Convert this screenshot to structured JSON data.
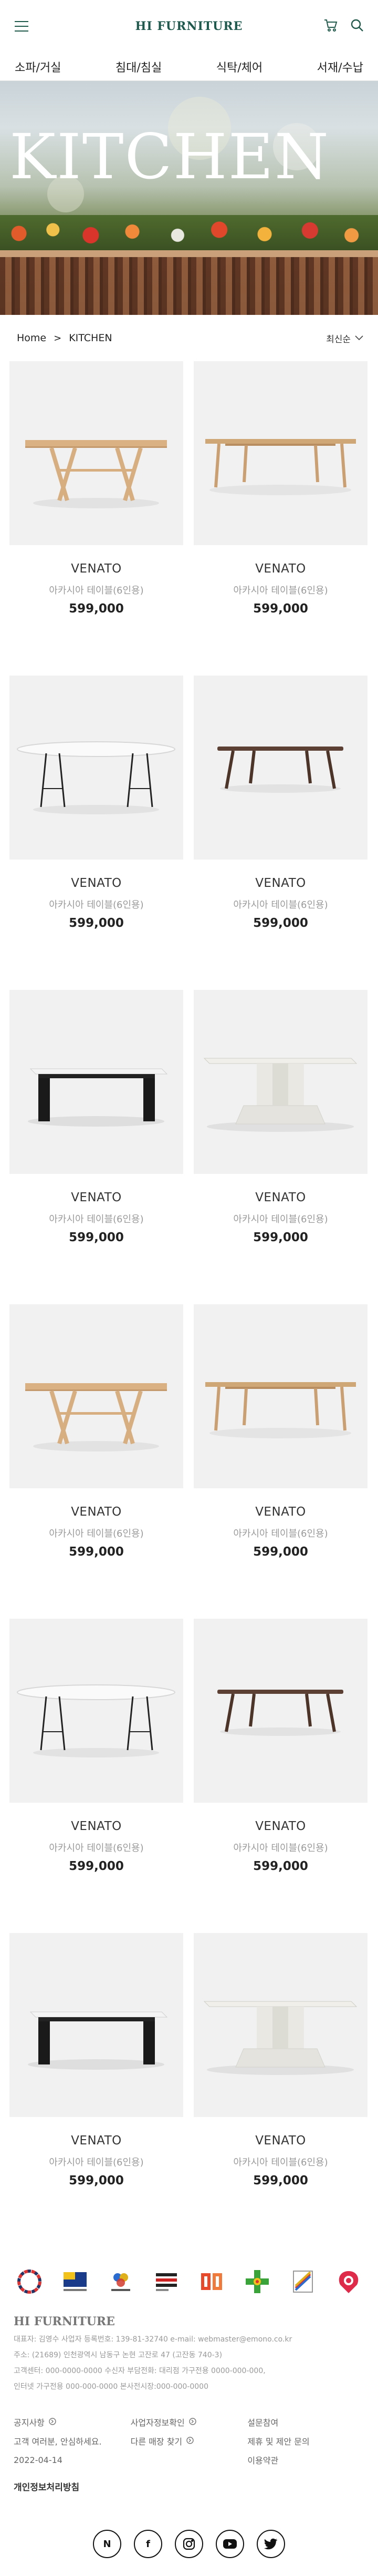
{
  "header": {
    "brand": "HI FURNITURE",
    "menu_icon": "hamburger-icon",
    "cart_icon": "cart-icon",
    "search_icon": "search-icon"
  },
  "categories": [
    "소파/거실",
    "침대/침실",
    "식탁/체어",
    "서재/수납"
  ],
  "hero": {
    "title": "KITCHEN"
  },
  "breadcrumb": {
    "home": "Home",
    "separator": ">",
    "current": "KITCHEN"
  },
  "sort": {
    "label": "최신순"
  },
  "products": [
    {
      "name": "VENATO",
      "desc": "아카시아 테이블(6인용)",
      "price": "599,000",
      "style": "oak-x"
    },
    {
      "name": "VENATO",
      "desc": "아카시아 테이블(6인용)",
      "price": "599,000",
      "style": "oak-long"
    },
    {
      "name": "VENATO",
      "desc": "아카시아 테이블(6인용)",
      "price": "599,000",
      "style": "white-oval"
    },
    {
      "name": "VENATO",
      "desc": "아카시아 테이블(6인용)",
      "price": "599,000",
      "style": "walnut"
    },
    {
      "name": "VENATO",
      "desc": "아카시아 테이블(6인용)",
      "price": "599,000",
      "style": "black-block"
    },
    {
      "name": "VENATO",
      "desc": "아카시아 테이블(6인용)",
      "price": "599,000",
      "style": "white-pedestal"
    },
    {
      "name": "VENATO",
      "desc": "아카시아 테이블(6인용)",
      "price": "599,000",
      "style": "oak-x"
    },
    {
      "name": "VENATO",
      "desc": "아카시아 테이블(6인용)",
      "price": "599,000",
      "style": "oak-long"
    },
    {
      "name": "VENATO",
      "desc": "아카시아 테이블(6인용)",
      "price": "599,000",
      "style": "white-oval"
    },
    {
      "name": "VENATO",
      "desc": "아카시아 테이블(6인용)",
      "price": "599,000",
      "style": "walnut"
    },
    {
      "name": "VENATO",
      "desc": "아카시아 테이블(6인용)",
      "price": "599,000",
      "style": "black-block"
    },
    {
      "name": "VENATO",
      "desc": "아카시아 테이블(6인용)",
      "price": "599,000",
      "style": "white-pedestal"
    }
  ],
  "footer": {
    "brand": "HI FURNITURE",
    "info_line1": "대표자: 김영수     사업자 등록번호: 139-81-32740 e-mail: webmaster@emono.co.kr",
    "info_line2": "주소: (21689) 인천광역시 남동구 논현 고잔로 47 (고잔동 740-3)",
    "info_line3": "고객센터: 000-0000-0000 수신자 부담전화: 대리점 가구전용 0000-000-000,",
    "info_line4": "인터넷 가구전용 000-000-0000 본사전시장:000-000-0000",
    "notice": "공지사항",
    "notice_sub": "고객 여러분, 안심하세요.",
    "notice_date": "2022-04-14",
    "biz_check": "사업자정보확인",
    "find_store": "다른 매장 찾기",
    "survey": "설문참여",
    "partnership": "제휴 및 제안 문의",
    "terms": "이용약관",
    "privacy": "개인정보처리방침",
    "social": [
      "N",
      "f",
      "instagram",
      "youtube",
      "twitter"
    ]
  }
}
